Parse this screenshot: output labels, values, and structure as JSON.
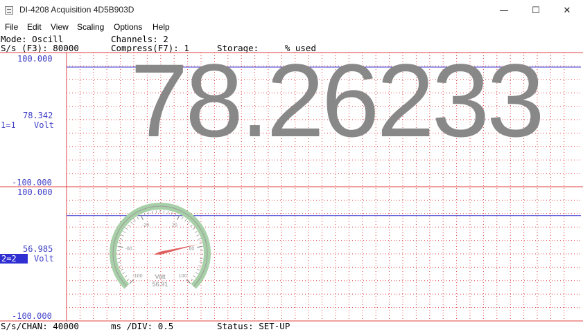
{
  "window": {
    "title": "DI-4208 Acquisition 4D5B903D",
    "minimize_glyph": "—",
    "maximize_glyph": "☐",
    "close_glyph": "✕"
  },
  "menu": [
    "File",
    "Edit",
    "View",
    "Scaling",
    "Options",
    "Help"
  ],
  "info": {
    "mode": "Mode: Oscill",
    "channels": "Channels: 2",
    "sample_rate": "S/s (F3): 80000",
    "compress": "Compress(F7): 1",
    "storage": "Storage:     % used"
  },
  "channel1": {
    "top": "100.000",
    "reading": "78.342",
    "label": "1=1",
    "unit": "Volt",
    "bottom": "-100.000"
  },
  "channel2": {
    "top": "100.000",
    "reading": "56.985",
    "label": "2=2",
    "unit": "Volt",
    "bottom": "-100.000"
  },
  "big_readout": "78.26233",
  "gauge": {
    "unit": "Volt",
    "value_text": "56.91",
    "value": 56.91,
    "min": -100,
    "max": 100,
    "tick_labels": [
      "-100",
      "-60",
      "-20",
      "20",
      "60",
      "100"
    ]
  },
  "status": {
    "chan_rate": "S/s/CHAN: 40000",
    "ms_div": "ms /DIV: 0.5",
    "status": "Status: SET-UP"
  },
  "colors": {
    "grid": "#e04040",
    "trace": "#3030d0",
    "scale_text": "#4040c8",
    "readout": "#888888",
    "gauge_ring": "#a8d0a8"
  }
}
